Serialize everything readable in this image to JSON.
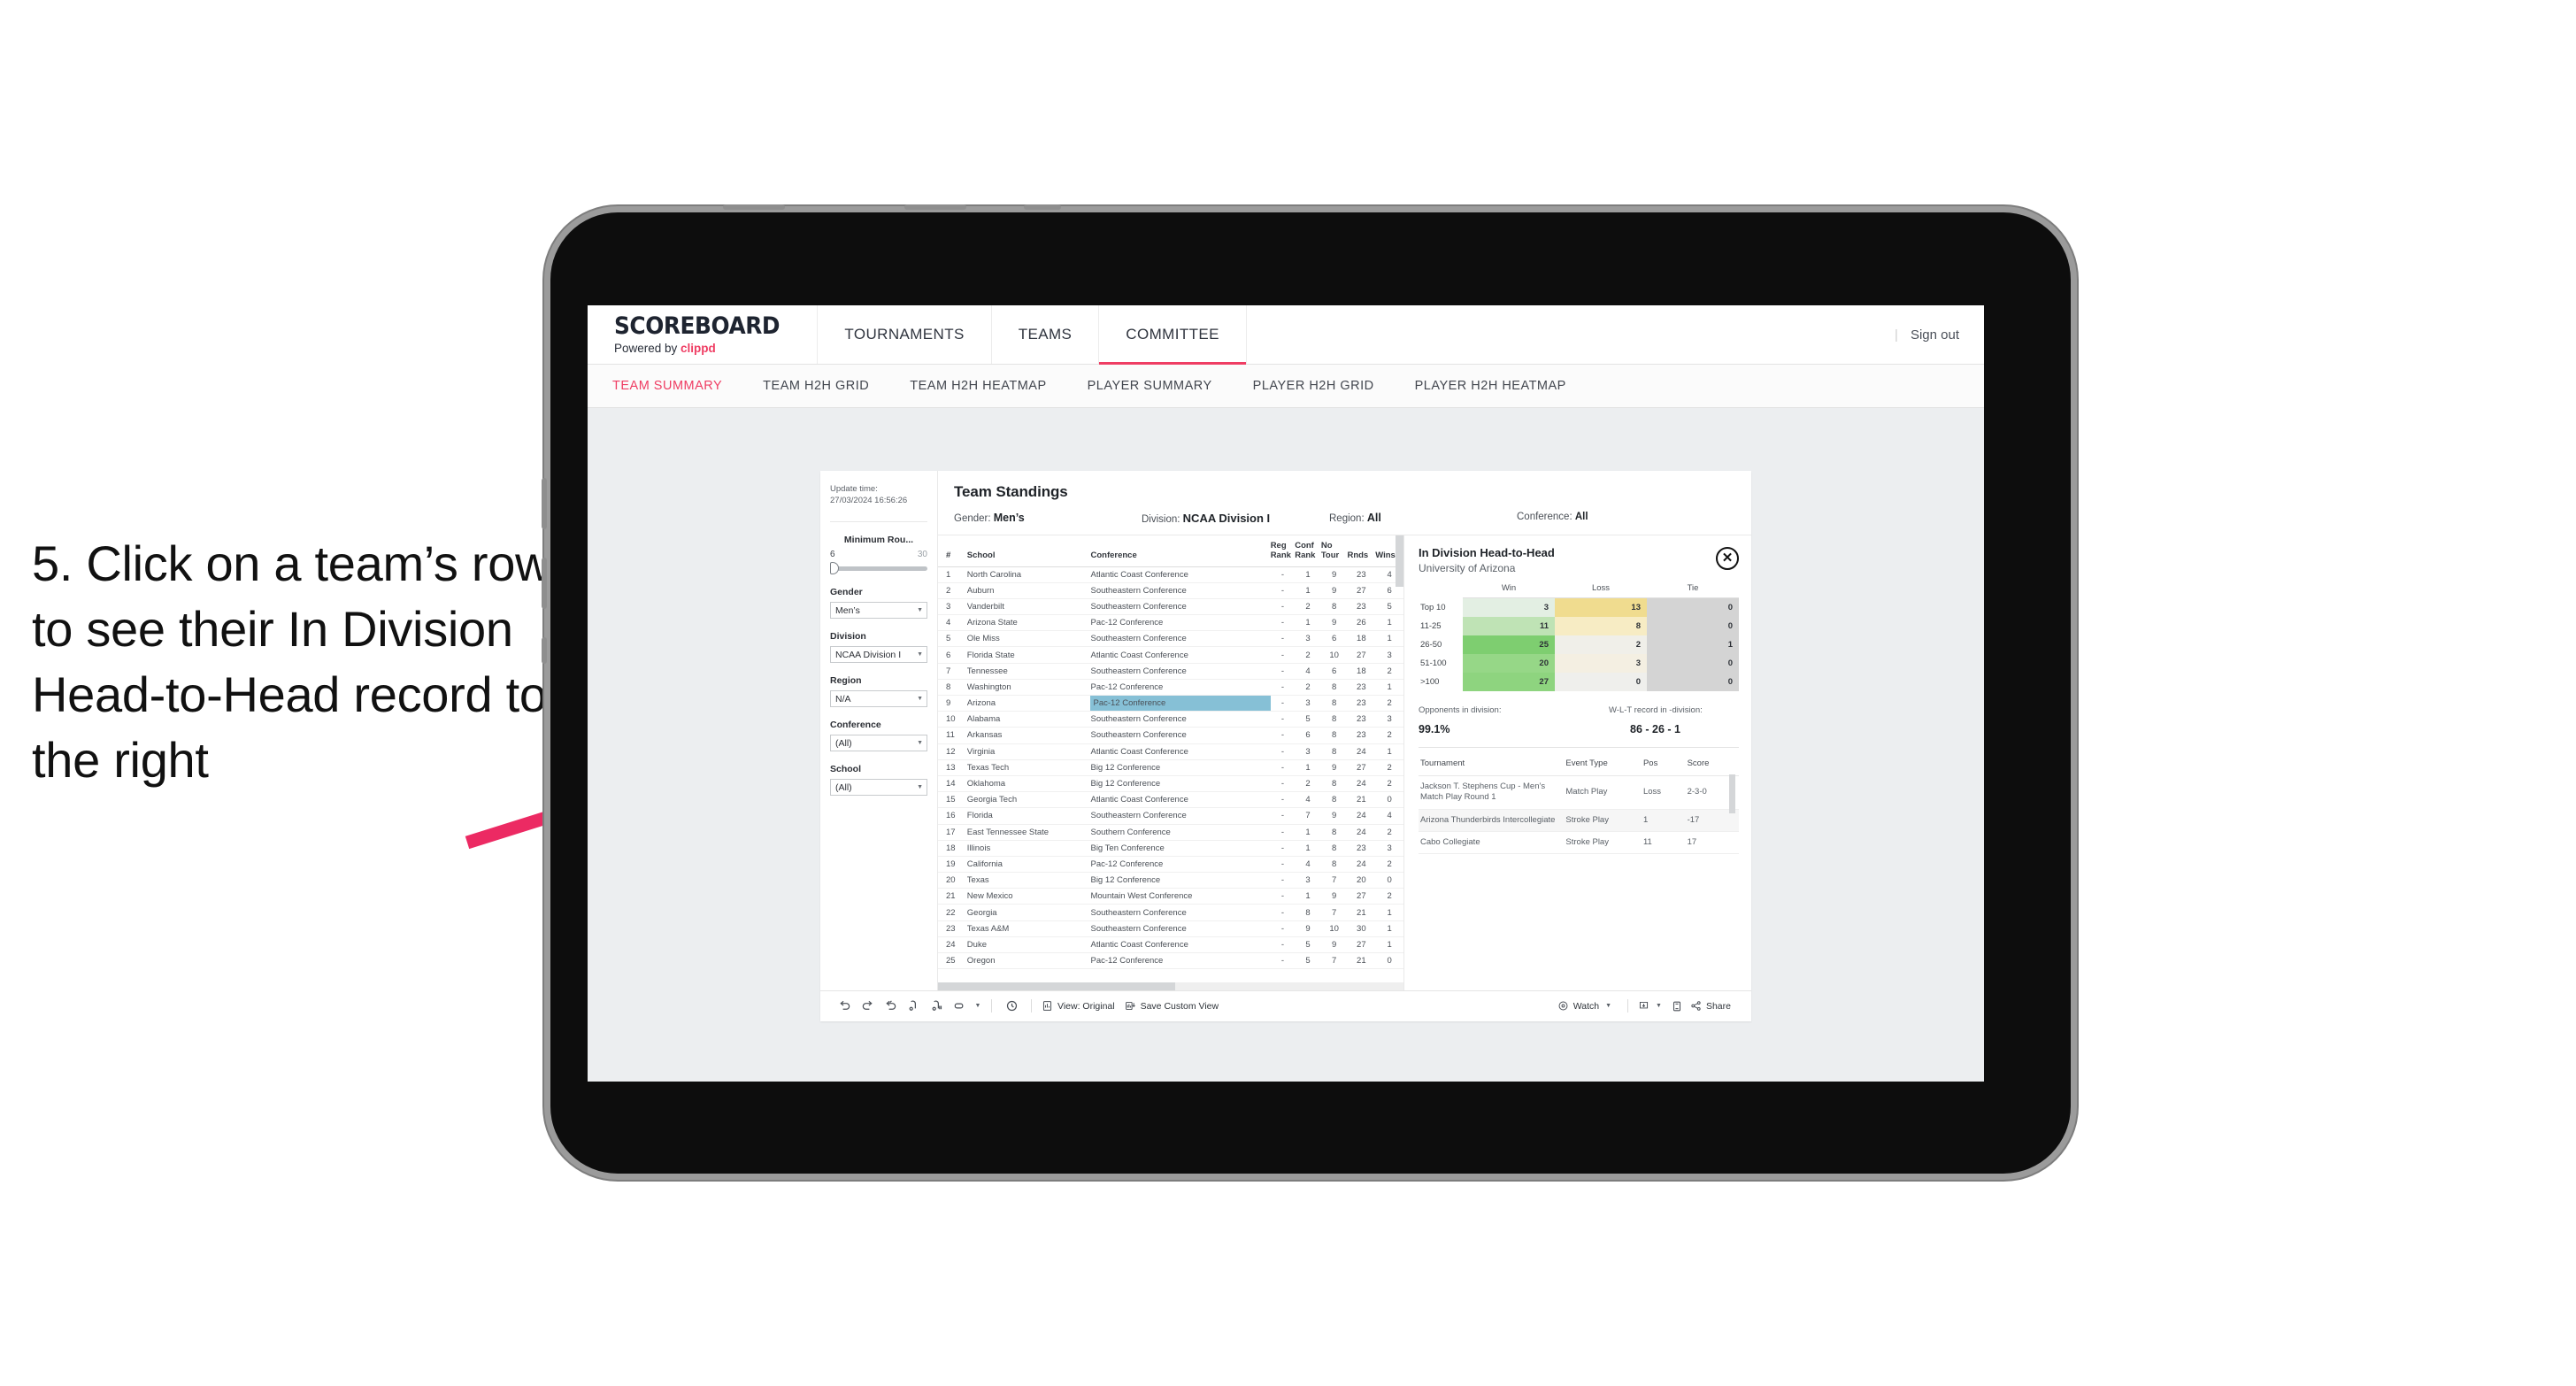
{
  "annotation": {
    "text": "5. Click on a team’s row to see their In Division Head-to-Head record to the right",
    "arrow_color": "#ec2a63"
  },
  "app": {
    "brand": {
      "title": "SCOREBOARD",
      "powered_prefix": "Powered by ",
      "powered_name": "clippd"
    },
    "top_nav": [
      {
        "label": "TOURNAMENTS",
        "active": false
      },
      {
        "label": "TEAMS",
        "active": false
      },
      {
        "label": "COMMITTEE",
        "active": true
      }
    ],
    "sign_out": "Sign out",
    "sub_tabs": [
      {
        "label": "TEAM SUMMARY",
        "active": true
      },
      {
        "label": "TEAM H2H GRID",
        "active": false
      },
      {
        "label": "TEAM H2H HEATMAP",
        "active": false
      },
      {
        "label": "PLAYER SUMMARY",
        "active": false
      },
      {
        "label": "PLAYER H2H GRID",
        "active": false
      },
      {
        "label": "PLAYER H2H HEATMAP",
        "active": false
      }
    ]
  },
  "filters": {
    "update_time_label": "Update time:",
    "update_time_value": "27/03/2024 16:56:26",
    "min_rounds": {
      "label": "Minimum Rou...",
      "min": "6",
      "max": "30",
      "value": 6
    },
    "gender": {
      "label": "Gender",
      "value": "Men’s"
    },
    "division": {
      "label": "Division",
      "value": "NCAA Division I"
    },
    "region": {
      "label": "Region",
      "value": "N/A"
    },
    "conference": {
      "label": "Conference",
      "value": "(All)"
    },
    "school": {
      "label": "School",
      "value": "(All)"
    }
  },
  "viz": {
    "title": "Team Standings",
    "filter_summary": [
      {
        "label": "Gender:",
        "value": "Men’s"
      },
      {
        "label": "Division:",
        "value": "NCAA Division I"
      },
      {
        "label": "Region:",
        "value": "All"
      },
      {
        "label": "Conference:",
        "value": "All"
      }
    ],
    "table": {
      "columns": [
        "#",
        "School",
        "Conference",
        "Reg Rank",
        "Conf Rank",
        "No Tour",
        "Rnds",
        "Wins"
      ],
      "column_lines": [
        [
          "#"
        ],
        [
          "School"
        ],
        [
          "Conference"
        ],
        [
          "Reg",
          "Rank"
        ],
        [
          "Conf",
          "Rank"
        ],
        [
          "No",
          "Tour"
        ],
        [
          "Rnds"
        ],
        [
          "Wins"
        ]
      ],
      "highlight_row_index": 8,
      "rows": [
        {
          "n": "1",
          "school": "North Carolina",
          "conf": "Atlantic Coast Conference",
          "reg": "-",
          "crank": "1",
          "notour": "9",
          "rnds": "23",
          "wins": "4"
        },
        {
          "n": "2",
          "school": "Auburn",
          "conf": "Southeastern Conference",
          "reg": "-",
          "crank": "1",
          "notour": "9",
          "rnds": "27",
          "wins": "6"
        },
        {
          "n": "3",
          "school": "Vanderbilt",
          "conf": "Southeastern Conference",
          "reg": "-",
          "crank": "2",
          "notour": "8",
          "rnds": "23",
          "wins": "5"
        },
        {
          "n": "4",
          "school": "Arizona State",
          "conf": "Pac-12 Conference",
          "reg": "-",
          "crank": "1",
          "notour": "9",
          "rnds": "26",
          "wins": "1"
        },
        {
          "n": "5",
          "school": "Ole Miss",
          "conf": "Southeastern Conference",
          "reg": "-",
          "crank": "3",
          "notour": "6",
          "rnds": "18",
          "wins": "1"
        },
        {
          "n": "6",
          "school": "Florida State",
          "conf": "Atlantic Coast Conference",
          "reg": "-",
          "crank": "2",
          "notour": "10",
          "rnds": "27",
          "wins": "3"
        },
        {
          "n": "7",
          "school": "Tennessee",
          "conf": "Southeastern Conference",
          "reg": "-",
          "crank": "4",
          "notour": "6",
          "rnds": "18",
          "wins": "2"
        },
        {
          "n": "8",
          "school": "Washington",
          "conf": "Pac-12 Conference",
          "reg": "-",
          "crank": "2",
          "notour": "8",
          "rnds": "23",
          "wins": "1"
        },
        {
          "n": "9",
          "school": "Arizona",
          "conf": "Pac-12 Conference",
          "reg": "-",
          "crank": "3",
          "notour": "8",
          "rnds": "23",
          "wins": "2"
        },
        {
          "n": "10",
          "school": "Alabama",
          "conf": "Southeastern Conference",
          "reg": "-",
          "crank": "5",
          "notour": "8",
          "rnds": "23",
          "wins": "3"
        },
        {
          "n": "11",
          "school": "Arkansas",
          "conf": "Southeastern Conference",
          "reg": "-",
          "crank": "6",
          "notour": "8",
          "rnds": "23",
          "wins": "2"
        },
        {
          "n": "12",
          "school": "Virginia",
          "conf": "Atlantic Coast Conference",
          "reg": "-",
          "crank": "3",
          "notour": "8",
          "rnds": "24",
          "wins": "1"
        },
        {
          "n": "13",
          "school": "Texas Tech",
          "conf": "Big 12 Conference",
          "reg": "-",
          "crank": "1",
          "notour": "9",
          "rnds": "27",
          "wins": "2"
        },
        {
          "n": "14",
          "school": "Oklahoma",
          "conf": "Big 12 Conference",
          "reg": "-",
          "crank": "2",
          "notour": "8",
          "rnds": "24",
          "wins": "2"
        },
        {
          "n": "15",
          "school": "Georgia Tech",
          "conf": "Atlantic Coast Conference",
          "reg": "-",
          "crank": "4",
          "notour": "8",
          "rnds": "21",
          "wins": "0"
        },
        {
          "n": "16",
          "school": "Florida",
          "conf": "Southeastern Conference",
          "reg": "-",
          "crank": "7",
          "notour": "9",
          "rnds": "24",
          "wins": "4"
        },
        {
          "n": "17",
          "school": "East Tennessee State",
          "conf": "Southern Conference",
          "reg": "-",
          "crank": "1",
          "notour": "8",
          "rnds": "24",
          "wins": "2"
        },
        {
          "n": "18",
          "school": "Illinois",
          "conf": "Big Ten Conference",
          "reg": "-",
          "crank": "1",
          "notour": "8",
          "rnds": "23",
          "wins": "3"
        },
        {
          "n": "19",
          "school": "California",
          "conf": "Pac-12 Conference",
          "reg": "-",
          "crank": "4",
          "notour": "8",
          "rnds": "24",
          "wins": "2"
        },
        {
          "n": "20",
          "school": "Texas",
          "conf": "Big 12 Conference",
          "reg": "-",
          "crank": "3",
          "notour": "7",
          "rnds": "20",
          "wins": "0"
        },
        {
          "n": "21",
          "school": "New Mexico",
          "conf": "Mountain West Conference",
          "reg": "-",
          "crank": "1",
          "notour": "9",
          "rnds": "27",
          "wins": "2"
        },
        {
          "n": "22",
          "school": "Georgia",
          "conf": "Southeastern Conference",
          "reg": "-",
          "crank": "8",
          "notour": "7",
          "rnds": "21",
          "wins": "1"
        },
        {
          "n": "23",
          "school": "Texas A&M",
          "conf": "Southeastern Conference",
          "reg": "-",
          "crank": "9",
          "notour": "10",
          "rnds": "30",
          "wins": "1"
        },
        {
          "n": "24",
          "school": "Duke",
          "conf": "Atlantic Coast Conference",
          "reg": "-",
          "crank": "5",
          "notour": "9",
          "rnds": "27",
          "wins": "1"
        },
        {
          "n": "25",
          "school": "Oregon",
          "conf": "Pac-12 Conference",
          "reg": "-",
          "crank": "5",
          "notour": "7",
          "rnds": "21",
          "wins": "0"
        }
      ]
    }
  },
  "h2h": {
    "title": "In Division Head-to-Head",
    "subtitle": "University of Arizona",
    "close_label": "✕",
    "stats": {
      "opponents_label": "Opponents in division:",
      "opponents_value": "99.1%",
      "record_label": "W-L-T record in -division:",
      "record_value": "86 - 26 - 1"
    },
    "tournaments": {
      "columns": [
        "Tournament",
        "Event Type",
        "Pos",
        "Score"
      ],
      "rows": [
        {
          "name": "Jackson T. Stephens Cup - Men’s Match Play Round 1",
          "type": "Match Play",
          "pos": "Loss",
          "score": "2-3-0"
        },
        {
          "name": "Arizona Thunderbirds Intercollegiate",
          "type": "Stroke Play",
          "pos": "1",
          "score": "-17"
        },
        {
          "name": "Cabo Collegiate",
          "type": "Stroke Play",
          "pos": "11",
          "score": "17"
        }
      ]
    }
  },
  "toolbar": {
    "icons": [
      "undo-icon",
      "redo-icon",
      "revert-icon",
      "refresh-icon",
      "pause-icon",
      "shape-icon"
    ],
    "view_label": "View: Original",
    "save_label": "Save Custom View",
    "watch_label": "Watch",
    "share_label": "Share"
  },
  "chart_data": {
    "type": "heatmap",
    "title": "In Division Head-to-Head",
    "subtitle": "University of Arizona",
    "xlabel": "",
    "ylabel": "",
    "columns": [
      "Win",
      "Loss",
      "Tie"
    ],
    "rows": [
      "Top 10",
      "11-25",
      "26-50",
      "51-100",
      ">100"
    ],
    "values": [
      [
        3,
        13,
        0
      ],
      [
        11,
        8,
        0
      ],
      [
        25,
        2,
        1
      ],
      [
        20,
        3,
        0
      ],
      [
        27,
        0,
        0
      ]
    ],
    "cell_colors": [
      [
        "#e3efe3",
        "#f0dc8f",
        "#d4d4d4"
      ],
      [
        "#bfe3b5",
        "#f7ecc4",
        "#d4d4d4"
      ],
      [
        "#7ece70",
        "#f0efe9",
        "#d4d4d4"
      ],
      [
        "#96d787",
        "#f4efe2",
        "#d4d4d4"
      ],
      [
        "#8ed47f",
        "#efefec",
        "#d4d4d4"
      ]
    ],
    "legend_position": "none",
    "grid": false
  }
}
